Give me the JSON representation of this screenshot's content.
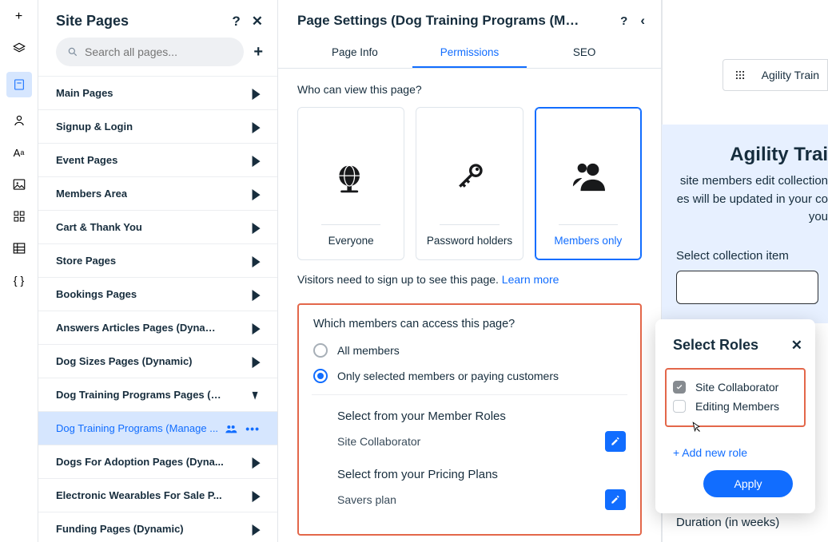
{
  "sidebar_title": "Site Pages",
  "search_placeholder": "Search all pages...",
  "pages": [
    {
      "label": "Main Pages",
      "state": "closed"
    },
    {
      "label": "Signup & Login",
      "state": "closed"
    },
    {
      "label": "Event Pages",
      "state": "closed"
    },
    {
      "label": "Members Area",
      "state": "closed"
    },
    {
      "label": "Cart & Thank You",
      "state": "closed"
    },
    {
      "label": "Store Pages",
      "state": "closed"
    },
    {
      "label": "Bookings Pages",
      "state": "closed"
    },
    {
      "label": "Answers Articles Pages (Dynamic)",
      "state": "closed"
    },
    {
      "label": "Dog Sizes Pages (Dynamic)",
      "state": "closed"
    },
    {
      "label": "Dog Training Programs Pages (D...",
      "state": "open"
    },
    {
      "label": "Dog Training Programs (Manage ...",
      "state": "selected"
    },
    {
      "label": "Dogs For Adoption Pages (Dyna...",
      "state": "closed"
    },
    {
      "label": "Electronic Wearables For Sale P...",
      "state": "closed"
    },
    {
      "label": "Funding Pages (Dynamic)",
      "state": "closed"
    }
  ],
  "settings": {
    "title": "Page Settings (Dog Training Programs (Manage ...",
    "tabs": {
      "info": "Page Info",
      "permissions": "Permissions",
      "seo": "SEO"
    },
    "who_can_view": "Who can view this page?",
    "cards": {
      "everyone": "Everyone",
      "password": "Password holders",
      "members": "Members only"
    },
    "visitors_prefix": "Visitors need to sign up to see this page. ",
    "learn_more": "Learn more",
    "which_members": "Which members can access this page?",
    "radio_all": "All members",
    "radio_selected": "Only selected members or paying customers",
    "sel_roles_title": "Select from your Member Roles",
    "role_value": "Site Collaborator",
    "sel_plans_title": "Select from your Pricing Plans",
    "plan_value": "Savers plan"
  },
  "right": {
    "breadcrumb": "Agility Train",
    "heading": "Agility Trai",
    "text_l1": "site members edit collection",
    "text_l2": "es will be updated in your co",
    "text_l3": "you",
    "select_label": "Select collection item",
    "duration": "Duration (in weeks)"
  },
  "roles_popup": {
    "title": "Select Roles",
    "r1": "Site Collaborator",
    "r2": "Editing Members",
    "add": "+ Add new role",
    "apply": "Apply"
  }
}
